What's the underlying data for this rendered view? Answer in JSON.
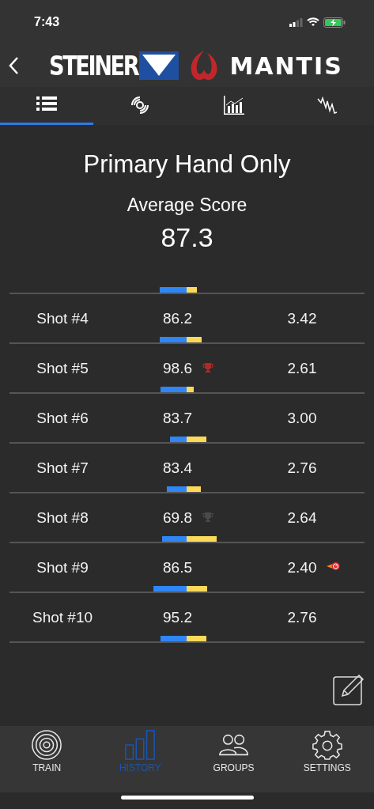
{
  "status_bar": {
    "time": "7:43"
  },
  "header": {
    "brand_left": "STEINER",
    "brand_right": "MANTIS"
  },
  "tabs": [
    {
      "kind": "list",
      "selected": true
    },
    {
      "kind": "target",
      "selected": false
    },
    {
      "kind": "chart",
      "selected": false
    },
    {
      "kind": "wave",
      "selected": false
    }
  ],
  "title": "Primary Hand Only",
  "average": {
    "label": "Average Score",
    "value": "87.3"
  },
  "shots": [
    {
      "name": "Shot #4",
      "score": "86.2",
      "time": "3.42"
    },
    {
      "name": "Shot #5",
      "score": "98.6",
      "time": "2.61",
      "score_award": {
        "kind": "trophy",
        "color": "#b02a2a"
      }
    },
    {
      "name": "Shot #6",
      "score": "83.7",
      "time": "3.00"
    },
    {
      "name": "Shot #7",
      "score": "83.4",
      "time": "2.76"
    },
    {
      "name": "Shot #8",
      "score": "69.8",
      "time": "2.64",
      "score_award": {
        "kind": "trophy",
        "color": "#4a4a4a"
      }
    },
    {
      "name": "Shot #9",
      "score": "86.5",
      "time": "2.40",
      "time_award": {
        "kind": "fastest"
      }
    },
    {
      "name": "Shot #10",
      "score": "95.2",
      "time": "2.76"
    }
  ],
  "nav": [
    {
      "kind": "train",
      "label": "TRAIN",
      "selected": false
    },
    {
      "kind": "history",
      "label": "HISTORY",
      "selected": true
    },
    {
      "kind": "groups",
      "label": "GROUPS",
      "selected": false
    },
    {
      "kind": "settings",
      "label": "SETTINGS",
      "selected": false
    }
  ]
}
